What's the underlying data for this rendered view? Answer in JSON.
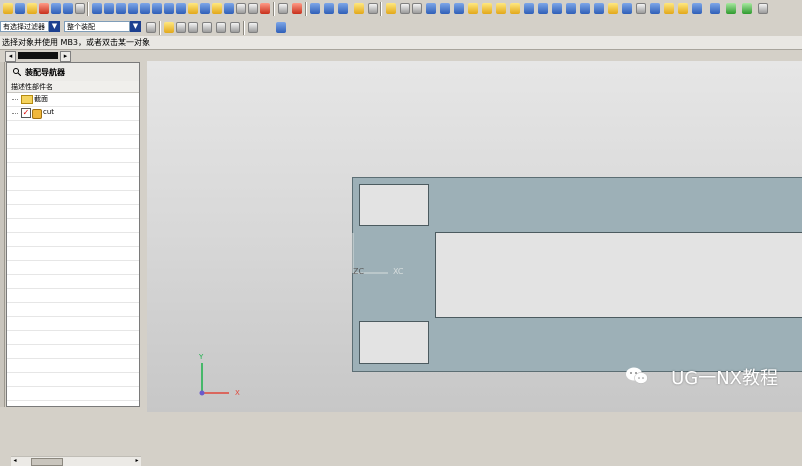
{
  "toolbar": {
    "filter_combo": "有选择过滤器",
    "scope_combo": "整个装配"
  },
  "hint": "选择对象并使用 MB3，或者双击某一对象",
  "navigator": {
    "title": "装配导航器",
    "column_header": "描述性部件名",
    "items": [
      {
        "label": "截面"
      },
      {
        "label": "cut"
      }
    ]
  },
  "viewport": {
    "wcs_labels": {
      "z": "ZC",
      "x": "XC"
    },
    "abs_axis_labels": {
      "y": "Y",
      "x": "X"
    }
  },
  "watermark": "UG一NX教程"
}
